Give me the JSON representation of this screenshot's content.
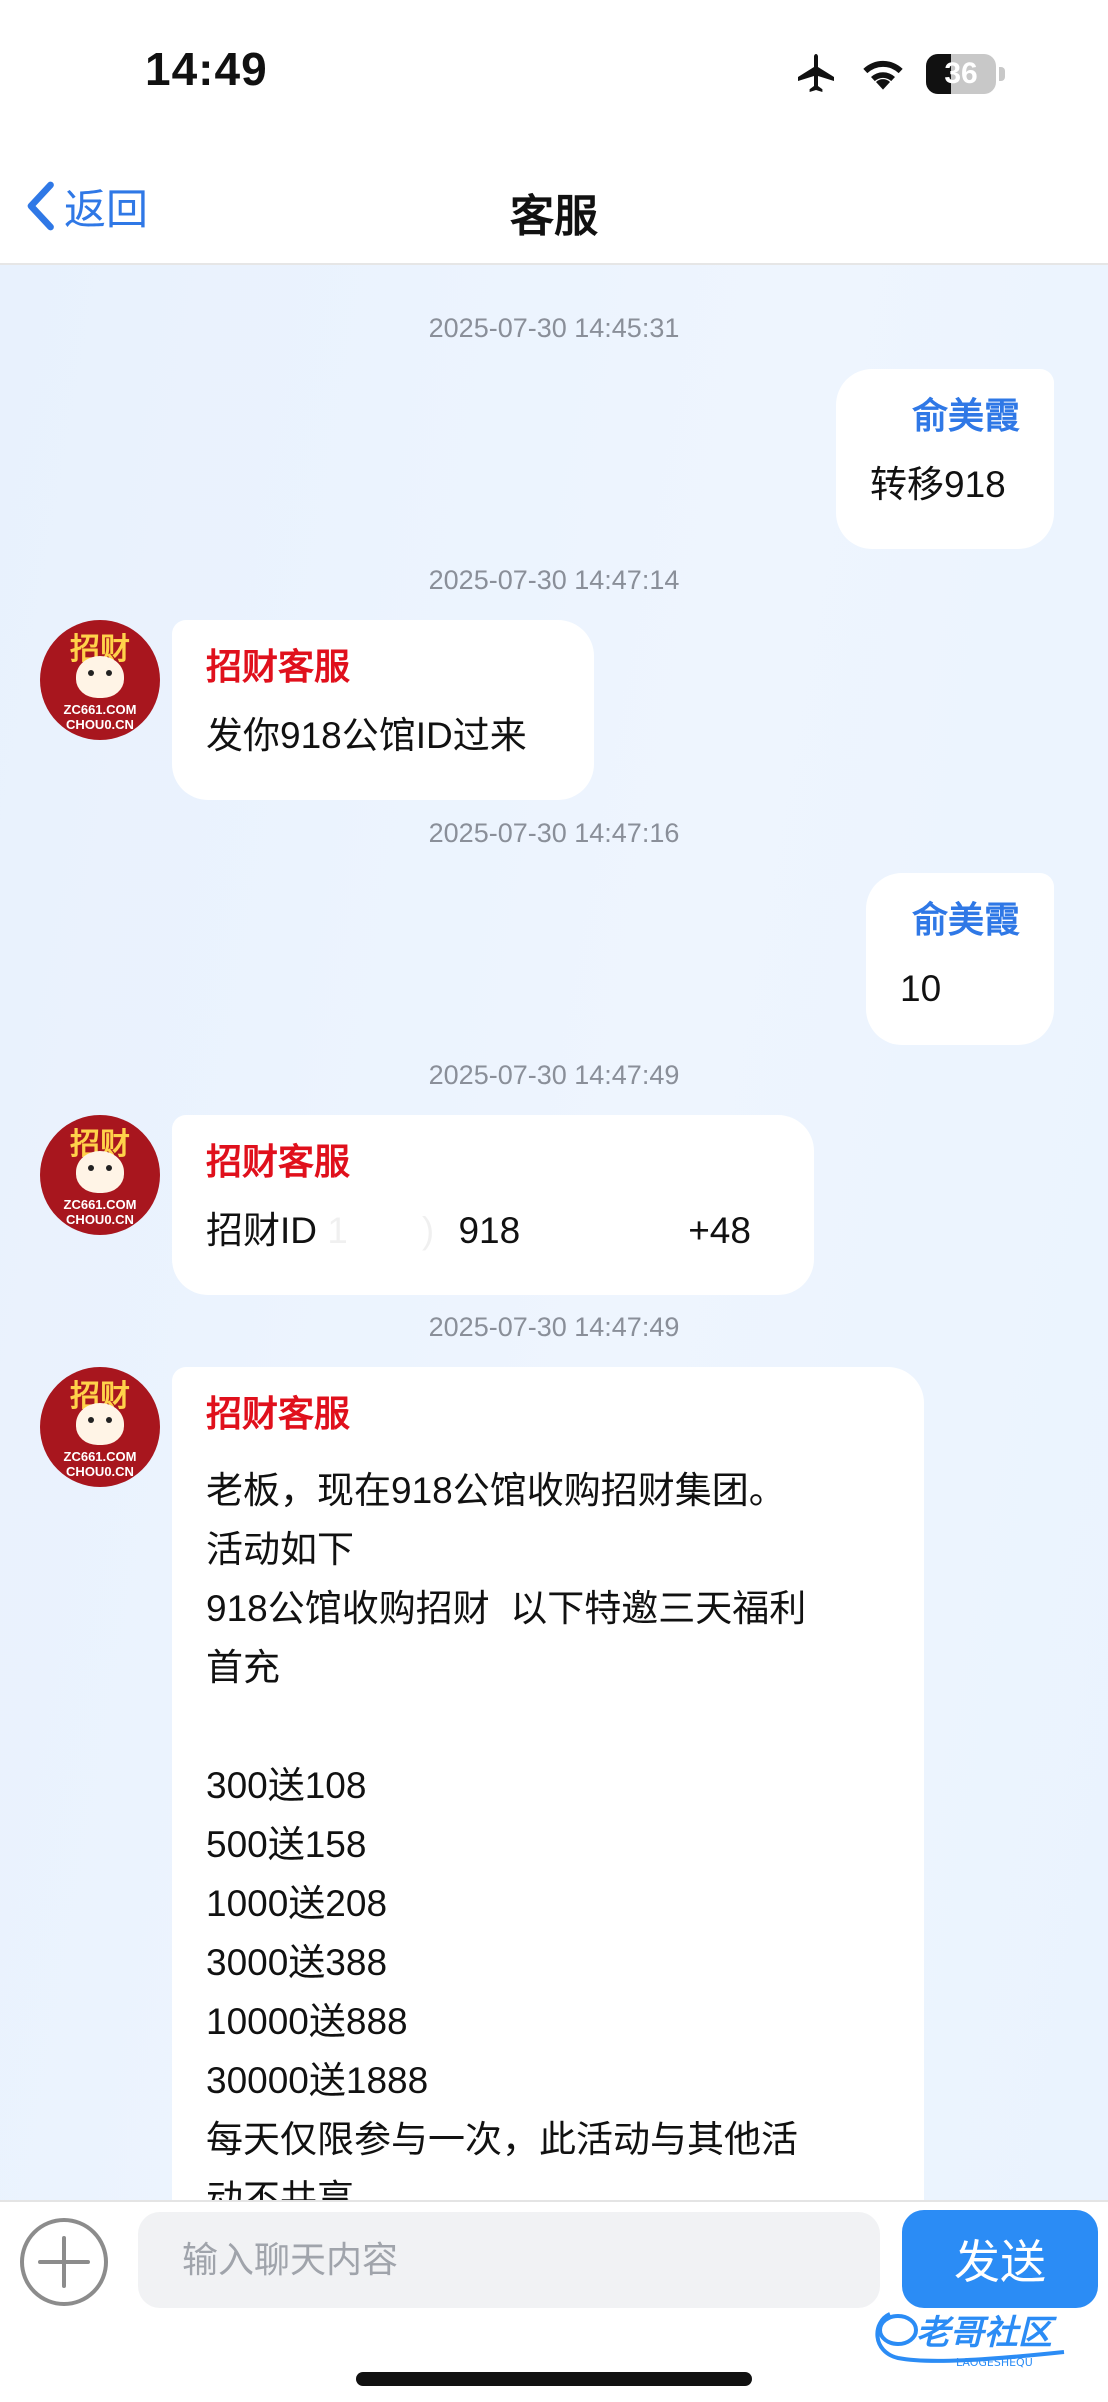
{
  "status_bar": {
    "time": "14:49",
    "battery": "36",
    "battery_level": 0.36
  },
  "header": {
    "back_label": "返回",
    "title": "客服"
  },
  "messages": [
    {
      "timestamp": "2025-07-30 14:45:31",
      "side": "right",
      "sender": "俞美霞",
      "text": "转移918"
    },
    {
      "timestamp": "2025-07-30 14:47:14",
      "side": "left",
      "sender": "招财客服",
      "text": "发你918公馆ID过来"
    },
    {
      "timestamp": "2025-07-30 14:47:16",
      "side": "right",
      "sender": "俞美霞",
      "text": "10"
    },
    {
      "timestamp": "2025-07-30 14:47:49",
      "side": "left",
      "sender": "招财客服",
      "text_parts": [
        "招财ID",
        "918",
        "+48"
      ]
    },
    {
      "timestamp": "2025-07-30 14:47:49",
      "side": "left",
      "sender": "招财客服",
      "text": "老板，现在918公馆收购招财集团。\n活动如下\n918公馆收购招财  以下特邀三天福利\n首充\n\n300送108\n500送158\n1000送208\n3000送388\n10000送888\n30000送1888\n每天仅限参与一次，此活动与其他活\n动不共享"
    }
  ],
  "avatar": {
    "top_text": "招财",
    "bottom_line1": "ZC661.COM",
    "bottom_line2": "CHOU0.CN"
  },
  "input": {
    "placeholder": "输入聊天内容",
    "value": ""
  },
  "send_label": "发送",
  "watermark": {
    "text": "老哥社区",
    "subtext": "LAOGESHEQU"
  },
  "colors": {
    "accent": "#2f78e6",
    "agent_name": "#e0101c",
    "send_button": "#2b8cf5"
  }
}
